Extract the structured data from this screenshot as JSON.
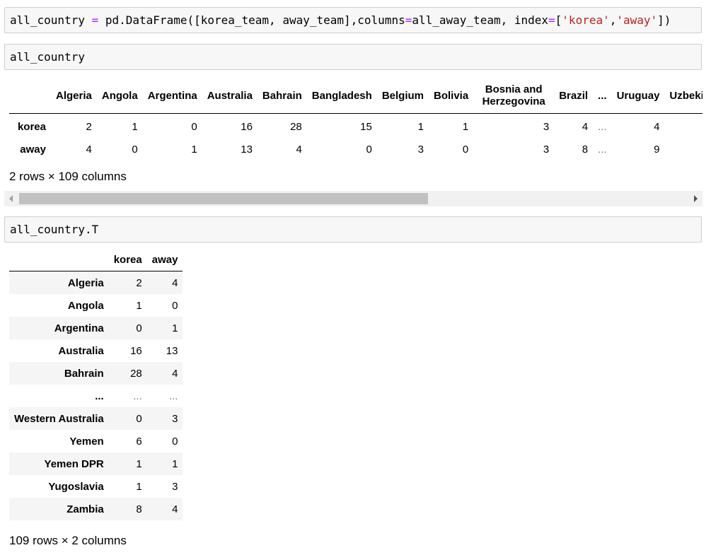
{
  "cells": {
    "cell1_tokens": [
      {
        "t": "all_country ",
        "c": ""
      },
      {
        "t": "=",
        "c": "op"
      },
      {
        "t": " pd.DataFrame([korea_team, away_team],columns",
        "c": ""
      },
      {
        "t": "=",
        "c": "op"
      },
      {
        "t": "all_away_team, index",
        "c": ""
      },
      {
        "t": "=",
        "c": "op"
      },
      {
        "t": "[",
        "c": ""
      },
      {
        "t": "'korea'",
        "c": "str"
      },
      {
        "t": ",",
        "c": ""
      },
      {
        "t": "'away'",
        "c": "str"
      },
      {
        "t": "])",
        "c": ""
      }
    ],
    "cell2_code": "all_country",
    "cell3_code": "all_country.T"
  },
  "df1": {
    "columns": [
      "",
      "Algeria",
      "Angola",
      "Argentina",
      "Australia",
      "Bahrain",
      "Bangladesh",
      "Belgium",
      "Bolivia",
      "Bosnia and Herzegovina",
      "Brazil",
      "...",
      "Uruguay",
      "Uzbekistan"
    ],
    "rows": [
      {
        "index": "korea",
        "values": [
          "2",
          "1",
          "0",
          "16",
          "28",
          "15",
          "1",
          "1",
          "3",
          "4",
          "...",
          "4",
          ""
        ]
      },
      {
        "index": "away",
        "values": [
          "4",
          "0",
          "1",
          "13",
          "4",
          "0",
          "3",
          "0",
          "3",
          "8",
          "...",
          "9",
          ""
        ]
      }
    ],
    "shape_caption": "2 rows × 109 columns"
  },
  "df2": {
    "columns": [
      "",
      "korea",
      "away"
    ],
    "rows": [
      {
        "index": "Algeria",
        "values": [
          "2",
          "4"
        ]
      },
      {
        "index": "Angola",
        "values": [
          "1",
          "0"
        ]
      },
      {
        "index": "Argentina",
        "values": [
          "0",
          "1"
        ]
      },
      {
        "index": "Australia",
        "values": [
          "16",
          "13"
        ]
      },
      {
        "index": "Bahrain",
        "values": [
          "28",
          "4"
        ]
      },
      {
        "index": "...",
        "values": [
          "...",
          "..."
        ]
      },
      {
        "index": "Western Australia",
        "values": [
          "0",
          "3"
        ]
      },
      {
        "index": "Yemen",
        "values": [
          "6",
          "0"
        ]
      },
      {
        "index": "Yemen DPR",
        "values": [
          "1",
          "1"
        ]
      },
      {
        "index": "Yugoslavia",
        "values": [
          "1",
          "3"
        ]
      },
      {
        "index": "Zambia",
        "values": [
          "8",
          "4"
        ]
      }
    ],
    "shape_caption": "109 rows × 2 columns"
  },
  "scrollbar": {
    "left_arrow_icon": "chevron-left-icon",
    "right_arrow_icon": "chevron-right-icon",
    "position": 0.0
  }
}
